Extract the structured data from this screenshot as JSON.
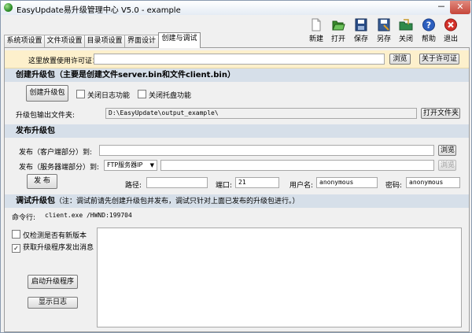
{
  "window": {
    "title": "EasyUpdate易升级管理中心 V5.0 - example"
  },
  "window_controls": {
    "minimize": "－",
    "close": "✕"
  },
  "tabs": [
    {
      "label": "系统项设置",
      "active": false
    },
    {
      "label": "文件项设置",
      "active": false
    },
    {
      "label": "目录项设置",
      "active": false
    },
    {
      "label": "界面设计",
      "active": false
    },
    {
      "label": "创建与调试",
      "active": true
    }
  ],
  "toolbar": {
    "new": {
      "label": "新建",
      "icon": "new-file-icon",
      "color": "#9a9a9a"
    },
    "open": {
      "label": "打开",
      "icon": "open-folder-icon",
      "color": "#3a8a2c"
    },
    "save": {
      "label": "保存",
      "icon": "floppy-save-icon",
      "color": "#2a4d86"
    },
    "save_as": {
      "label": "另存",
      "icon": "floppy-save-as-icon",
      "color": "#3b5e95"
    },
    "close": {
      "label": "关闭",
      "icon": "close-file-icon",
      "color": "#2f8a4a"
    },
    "help": {
      "label": "帮助",
      "icon": "help-icon",
      "color": "#2d5fbf"
    },
    "exit": {
      "label": "退出",
      "icon": "exit-icon",
      "color": "#d3312a"
    }
  },
  "license": {
    "label": "这里放置使用许可证：",
    "value": "",
    "browse": "浏览",
    "about": "关于许可证"
  },
  "create_section": {
    "title": "创建升级包（主要是创建文件server.bin和文件client.bin）",
    "create_button": "创建升级包",
    "disable_log": "关闭日志功能",
    "disable_tray": "关闭托盘功能",
    "output_label": "升级包输出文件夹:",
    "output_path": "D:\\EasyUpdate\\output_example\\",
    "open_folder": "打开文件夹"
  },
  "publish_section": {
    "title": "发布升级包",
    "client_label": "发布（客户端部分）到:",
    "client_value": "",
    "client_browse": "浏览",
    "server_label": "发布（服务器端部分）到:",
    "server_type": "FTP服务器IP",
    "server_value": "",
    "server_browse": "浏览",
    "publish_button": "发 布",
    "path_label": "路径:",
    "path_value": "",
    "port_label": "端口:",
    "port_value": "21",
    "user_label": "用户名:",
    "user_value": "anonymous",
    "password_label": "密码:",
    "password_value": "anonymous"
  },
  "debug_section": {
    "title": "调试升级包",
    "note": "（注：调试前请先创建升级包并发布，调试只针对上面已发布的升级包进行。）",
    "cmd_label": "命令行:",
    "cmd_value": "client.exe /HWND:199704",
    "check_only": "仅检测是否有新版本",
    "check_only_checked": false,
    "get_messages": "获取升级程序发出消息",
    "get_messages_checked": true,
    "start_button": "启动升级程序",
    "show_log_button": "显示日志"
  },
  "colors": {
    "license_bg": "#fdf0cc",
    "section_bg": "#d6dfe9",
    "accent_green": "#3a8a2c"
  }
}
